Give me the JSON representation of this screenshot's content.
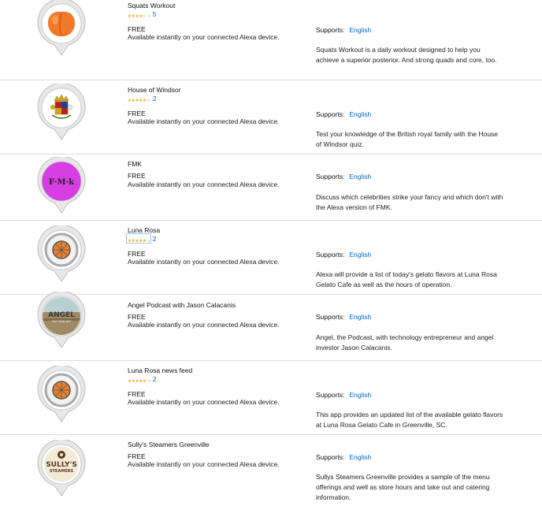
{
  "colors": {
    "link": "#0066c0",
    "star": "#f0a30a",
    "divider": "#dcdcdc"
  },
  "skills": [
    {
      "title": "Squats Workout",
      "icon": "peach-icon",
      "rating": 4,
      "review_count": "5",
      "price": "FREE",
      "availability": "Available instantly on your connected Alexa device.",
      "supports_label": "Supports:",
      "language": "English",
      "description": "Squats Workout is a daily workout designed to help you achieve a superior posterior. And strong quads and core, too."
    },
    {
      "title": "House of Windsor",
      "icon": "royal-crest-icon",
      "rating": 5,
      "review_count": "2",
      "price": "FREE",
      "availability": "Available instantly on your connected Alexa device.",
      "supports_label": "Supports:",
      "language": "English",
      "description": "Test your knowledge of the British royal family with the House of Windsor quiz."
    },
    {
      "title": "FMK",
      "icon_text": "F·M·k",
      "icon": "fmk-logo-icon",
      "price": "FREE",
      "availability": "Available instantly on your connected Alexa device.",
      "supports_label": "Supports:",
      "language": "English",
      "description": "Discuss which celebrities strike your fancy and which don't with the Alexa version of FMK."
    },
    {
      "title": "Luna Rosa",
      "icon": "gelato-badge-icon",
      "rating": 5,
      "review_count": "2",
      "price": "FREE",
      "availability": "Available instantly on your connected Alexa device.",
      "supports_label": "Supports:",
      "language": "English",
      "description": "Alexa will provide a list of today's gelato flavors at Luna Rosa Gelato Cafe as well as the hours of operation."
    },
    {
      "title": "Angel Podcast with Jason Calacanis",
      "icon": "angel-podcast-icon",
      "icon_text": "ANGEL",
      "icon_subtext": "THE PODCAST",
      "price": "FREE",
      "availability": "Available instantly on your connected Alexa device.",
      "supports_label": "Supports:",
      "language": "English",
      "description": "Angel, the Podcast, with technology entrepreneur and angel investor Jason Calacanis."
    },
    {
      "title": "Luna Rosa news feed",
      "icon": "gelato-badge-icon",
      "rating": 5,
      "review_count": "2",
      "price": "FREE",
      "availability": "Available instantly on your connected Alexa device.",
      "supports_label": "Supports:",
      "language": "English",
      "description": "This app provides an updated list of the available gelato flavors at Luna Rosa Gelato Cafe in Greenville, SC."
    },
    {
      "title": "Sully's Steamers Greenville",
      "icon": "sullys-logo-icon",
      "icon_text": "SULLY'S",
      "icon_subtext": "STEAMERS",
      "price": "FREE",
      "availability": "Available instantly on your connected Alexa device.",
      "supports_label": "Supports:",
      "language": "English",
      "description": "Sullys Steamers Greenville provides a sample of the menu offerings and well as store hours and take out and catering information."
    }
  ]
}
